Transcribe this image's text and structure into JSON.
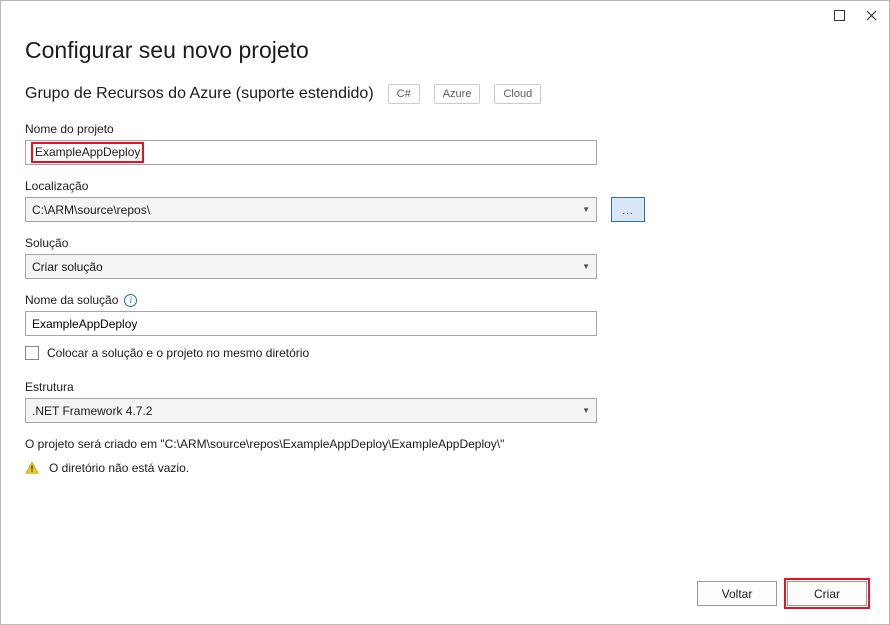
{
  "header": {
    "title": "Configurar seu novo projeto",
    "subtitle": "Grupo de Recursos do Azure (suporte estendido)",
    "tags": [
      "C#",
      "Azure",
      "Cloud"
    ]
  },
  "fields": {
    "projectName": {
      "label": "Nome do projeto",
      "value": "ExampleAppDeploy"
    },
    "location": {
      "label": "Localização",
      "value": "C:\\ARM\\source\\repos\\",
      "browse": "..."
    },
    "solution": {
      "label": "Solução",
      "value": "Criar solução"
    },
    "solutionName": {
      "label": "Nome da solução",
      "value": "ExampleAppDeploy"
    },
    "sameDirCheckbox": {
      "label": "Colocar a solução e o projeto no mesmo diretório"
    },
    "framework": {
      "label": "Estrutura",
      "value": ".NET Framework 4.7.2"
    }
  },
  "messages": {
    "createdIn": "O projeto será criado em \"C:\\ARM\\source\\repos\\ExampleAppDeploy\\ExampleAppDeploy\\\"",
    "warning": "O diretório não está vazio."
  },
  "footer": {
    "back": "Voltar",
    "create": "Criar"
  }
}
